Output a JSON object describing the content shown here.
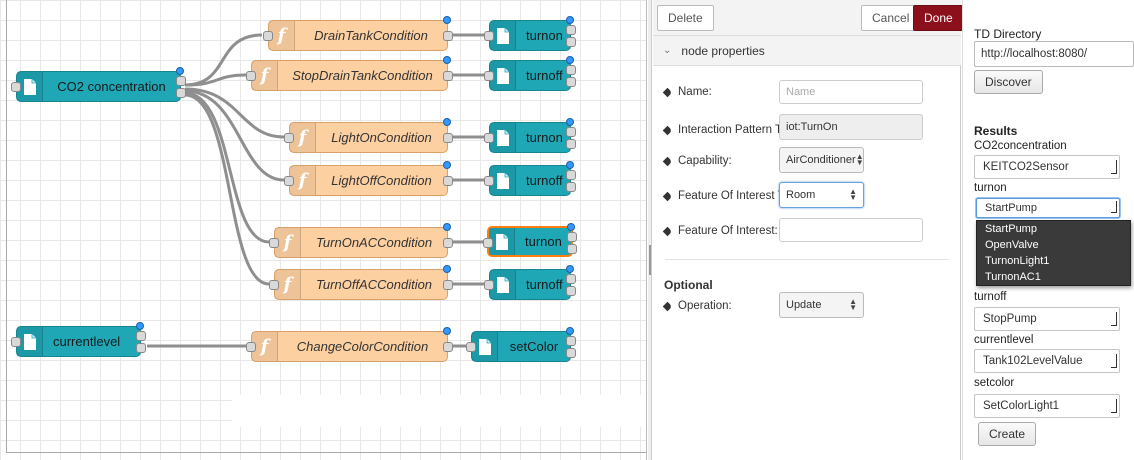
{
  "canvas": {
    "nodes": {
      "co2": "CO2 concentration",
      "currentlevel": "currentlevel",
      "drain": "DrainTankCondition",
      "stopdrain": "StopDrainTankCondition",
      "lighton": "LightOnCondition",
      "lightoff": "LightOffCondition",
      "turnonac": "TurnOnACCondition",
      "turnoffac": "TurnOffACCondition",
      "changecolor": "ChangeColorCondition",
      "out1": "turnon",
      "out2": "turnoff",
      "out3": "turnon",
      "out4": "turnoff",
      "out5": "turnon",
      "out6": "turnoff",
      "out7": "setColor"
    },
    "colors": {
      "teal": "#1fa7b6",
      "orange": "#fdd0a2",
      "status": "#3399ff",
      "selected": "#ff7f0e"
    }
  },
  "props": {
    "delete_label": "Delete",
    "cancel_label": "Cancel",
    "done_label": "Done",
    "section_title": "node properties",
    "name_label": "Name:",
    "name_placeholder": "Name",
    "pattern_label": "Interaction Pattern Type:",
    "pattern_value": "iot:TurnOn",
    "capability_label": "Capability:",
    "capability_value": "AirConditioner",
    "foi_type_label": "Feature Of Interest Type:",
    "foi_type_value": "Room",
    "foi_label": "Feature Of Interest:",
    "foi_value": "",
    "optional_heading": "Optional",
    "operation_label": "Operation:",
    "operation_value": "Update",
    "done_color": "#8c101c"
  },
  "td": {
    "title": "TD Directory",
    "url": "http://localhost:8080/",
    "discover_label": "Discover",
    "results_heading": "Results",
    "co2_label": "CO2concentration",
    "co2_value": "KEITCO2Sensor",
    "turnon_label": "turnon",
    "turnon_value": "StartPump",
    "turnon_options": [
      "StartPump",
      "OpenValve",
      "TurnonLight1",
      "TurnonAC1"
    ],
    "turnoff_label": "turnoff",
    "turnoff_value": "StopPump",
    "currentlevel_label": "currentlevel",
    "currentlevel_value": "Tank102LevelValue",
    "setcolor_label": "setcolor",
    "setcolor_value": "SetColorLight1",
    "create_label": "Create"
  }
}
